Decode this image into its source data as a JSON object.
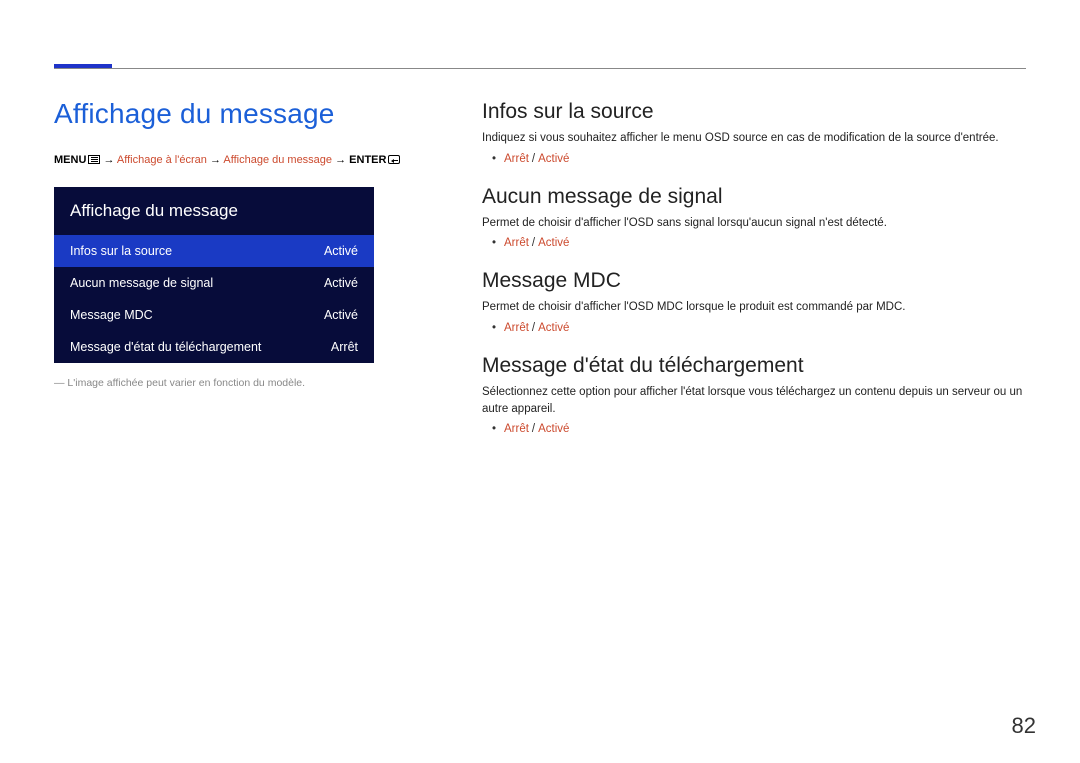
{
  "page_number": "82",
  "header": {
    "title": "Affichage du message"
  },
  "breadcrumb": {
    "menu_label": "MENU",
    "arrow": "→",
    "path1": "Affichage à l'écran",
    "path2": "Affichage du message",
    "enter_label": "ENTER"
  },
  "menu": {
    "title": "Affichage du message",
    "rows": [
      {
        "label": "Infos sur la source",
        "value": "Activé",
        "selected": true
      },
      {
        "label": "Aucun message de signal",
        "value": "Activé",
        "selected": false
      },
      {
        "label": "Message MDC",
        "value": "Activé",
        "selected": false
      },
      {
        "label": "Message d'état du téléchargement",
        "value": "Arrêt",
        "selected": false
      }
    ]
  },
  "note": "― L'image affichée peut varier en fonction du modèle.",
  "sections": [
    {
      "title": "Infos sur la source",
      "desc": "Indiquez si vous souhaitez afficher le menu OSD source en cas de modification de la source d'entrée.",
      "opt_a": "Arrêt",
      "opt_b": "Activé"
    },
    {
      "title": "Aucun message de signal",
      "desc": "Permet de choisir d'afficher l'OSD sans signal lorsqu'aucun signal n'est détecté.",
      "opt_a": "Arrêt",
      "opt_b": "Activé"
    },
    {
      "title": "Message MDC",
      "desc": "Permet de choisir d'afficher l'OSD MDC lorsque le produit est commandé par MDC.",
      "opt_a": "Arrêt",
      "opt_b": "Activé"
    },
    {
      "title": "Message d'état du téléchargement",
      "desc": "Sélectionnez cette option pour afficher l'état lorsque vous téléchargez un contenu depuis un serveur ou un autre appareil.",
      "opt_a": "Arrêt",
      "opt_b": "Activé"
    }
  ]
}
